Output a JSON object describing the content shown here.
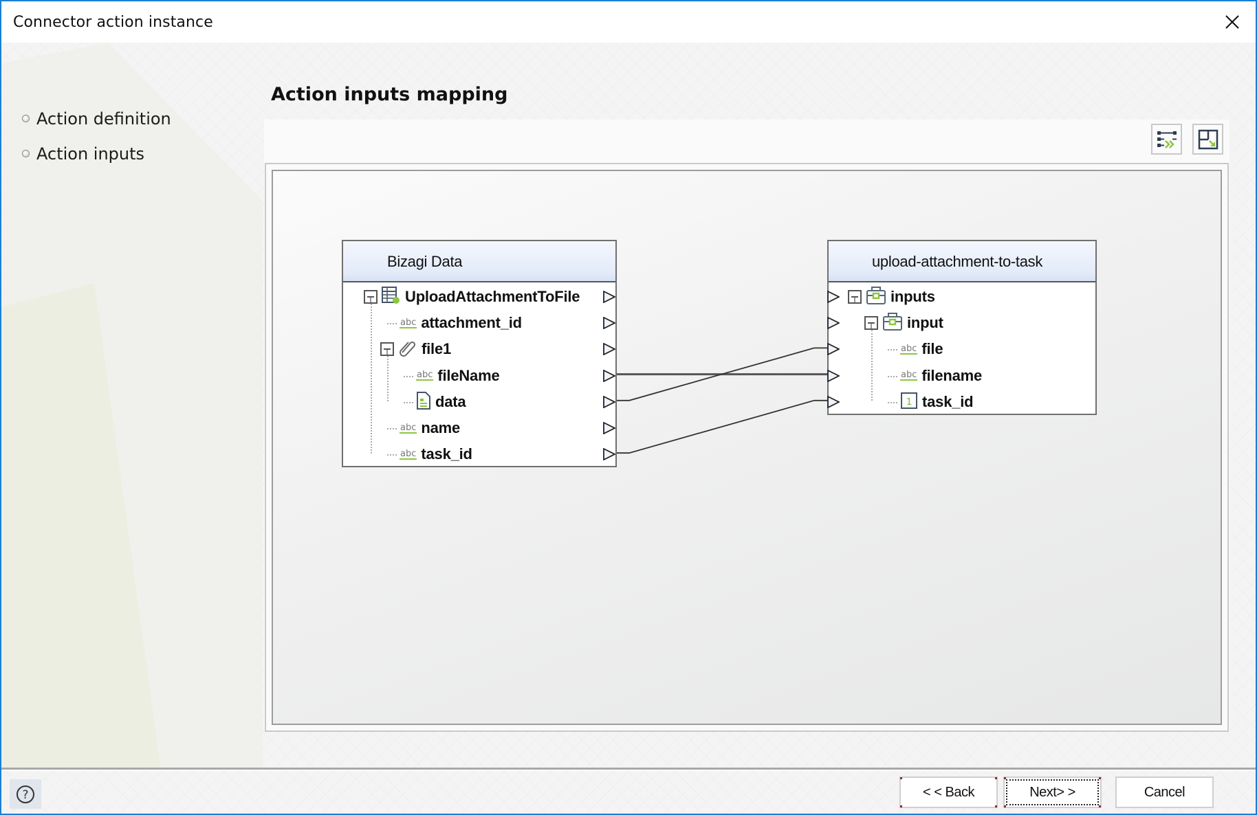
{
  "window": {
    "title": "Connector action instance",
    "close_icon": "close-icon",
    "accent_color": "#1a7fd6"
  },
  "sidebar": {
    "items": [
      {
        "label": "Action definition",
        "icon": "bullet-icon"
      },
      {
        "label": "Action inputs",
        "icon": "bullet-icon"
      }
    ]
  },
  "main": {
    "title": "Action inputs mapping",
    "toolbar": [
      {
        "name": "auto-map-button",
        "icon": "auto-map-icon"
      },
      {
        "name": "fit-layout-button",
        "icon": "layout-resize-icon"
      }
    ],
    "source": {
      "title": "Bizagi Data",
      "rows": [
        {
          "label": "UploadAttachmentToFile",
          "icon": "entity-table-icon",
          "level": 0,
          "expander": true
        },
        {
          "label": "attachment_id",
          "icon": "string-abc-icon",
          "level": 1,
          "expander": false
        },
        {
          "label": "file1",
          "icon": "attachment-paperclip-icon",
          "level": 1,
          "expander": true
        },
        {
          "label": "fileName",
          "icon": "string-abc-icon",
          "level": 2,
          "expander": false
        },
        {
          "label": "data",
          "icon": "document-icon",
          "level": 2,
          "expander": false
        },
        {
          "label": "name",
          "icon": "string-abc-icon",
          "level": 1,
          "expander": false
        },
        {
          "label": "task_id",
          "icon": "string-abc-icon",
          "level": 1,
          "expander": false
        }
      ]
    },
    "target": {
      "title": "upload-attachment-to-task",
      "rows": [
        {
          "label": "inputs",
          "icon": "object-briefcase-icon",
          "level": 0,
          "expander": true
        },
        {
          "label": "input",
          "icon": "object-briefcase-icon",
          "level": 1,
          "expander": true
        },
        {
          "label": "file",
          "icon": "string-abc-icon",
          "level": 2,
          "expander": false
        },
        {
          "label": "filename",
          "icon": "string-abc-icon",
          "level": 2,
          "expander": false
        },
        {
          "label": "task_id",
          "icon": "integer-icon",
          "level": 2,
          "expander": false
        }
      ]
    },
    "mappings": [
      {
        "from": "fileName",
        "to": "filename"
      },
      {
        "from": "data",
        "to": "file"
      },
      {
        "from": "task_id",
        "to": "task_id"
      }
    ],
    "abc_label": "abc",
    "integer_label": "1"
  },
  "footer": {
    "help_icon": "help-icon",
    "back_label": "< < Back",
    "next_label": "Next> >",
    "cancel_label": "Cancel"
  }
}
